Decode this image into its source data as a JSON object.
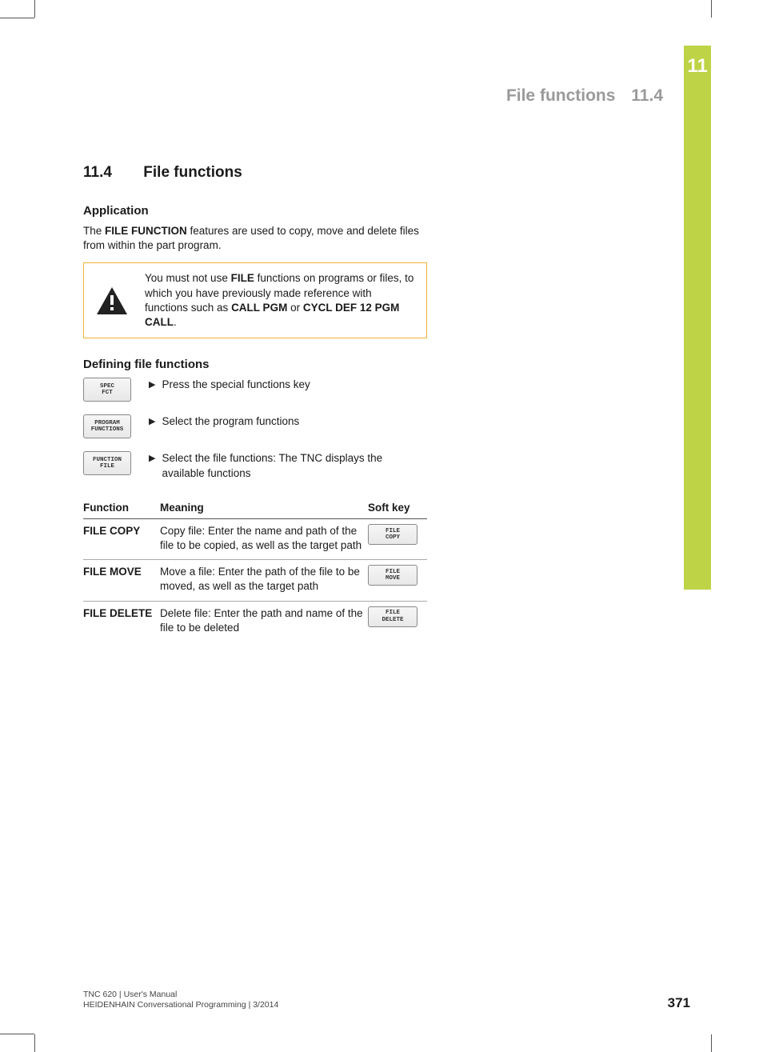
{
  "chapter_tab": "11",
  "header": {
    "title": "File functions",
    "section": "11.4"
  },
  "h1": {
    "num": "11.4",
    "title": "File functions"
  },
  "app": {
    "heading": "Application",
    "intro_pre": "The ",
    "intro_bold": "FILE FUNCTION",
    "intro_post": " features are used to copy, move and delete files from within the part program."
  },
  "warn": {
    "t1": "You must not use ",
    "b1": "FILE",
    "t2": " functions on programs or files, to which you have previously made reference with functions such as ",
    "b2": "CALL PGM",
    "t3": " or ",
    "b3": "CYCL DEF 12 PGM CALL",
    "t4": "."
  },
  "def": {
    "heading": "Defining file functions",
    "steps": [
      {
        "key": "SPEC\nFCT",
        "text": "Press the special functions key"
      },
      {
        "key": "PROGRAM\nFUNCTIONS",
        "text": "Select the program functions"
      },
      {
        "key": "FUNCTION\nFILE",
        "text": "Select the file functions: The TNC displays the available functions"
      }
    ]
  },
  "table": {
    "headers": {
      "fn": "Function",
      "meaning": "Meaning",
      "softkey": "Soft key"
    },
    "rows": [
      {
        "fn": "FILE COPY",
        "meaning": "Copy file: Enter the name and path of the file to be copied, as well as the target path",
        "softkey": "FILE\nCOPY"
      },
      {
        "fn": "FILE MOVE",
        "meaning": "Move a file: Enter the path of the file to be moved, as well as the target path",
        "softkey": "FILE\nMOVE"
      },
      {
        "fn": "FILE DELETE",
        "meaning": "Delete file: Enter the path and name of the file to be deleted",
        "softkey": "FILE\nDELETE"
      }
    ]
  },
  "footer": {
    "line1": "TNC 620 | User's Manual",
    "line2": "HEIDENHAIN Conversational Programming | 3/2014"
  },
  "page_number": "371"
}
